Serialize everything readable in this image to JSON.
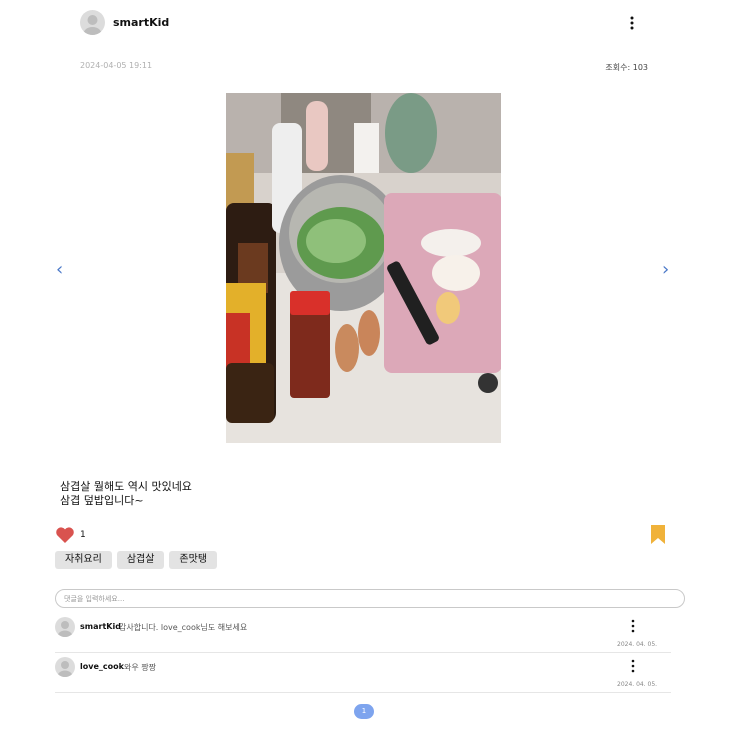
{
  "post": {
    "author": "smartKid",
    "date": "2024-04-05 19:11",
    "views": "조회수: 103",
    "text_line1": "삼겹살 뭘해도 역시 맛있네요",
    "text_line2": "삼겹 덮밥입니다~",
    "like_count": "1",
    "liked": true,
    "bookmarked": true
  },
  "carousel": {
    "prev": "‹",
    "next": "›"
  },
  "tags": [
    "자취요리",
    "삼겹살",
    "존맛탱"
  ],
  "comment_box": {
    "placeholder": "댓글을 입력하세요..."
  },
  "comments": [
    {
      "author": "smartKid",
      "text": "감사합니다. love_cook님도 해보세요",
      "date": "2024. 04. 05."
    },
    {
      "author": "love_cook",
      "text": "와우 짱짱",
      "date": "2024. 04. 05."
    }
  ],
  "pagination": {
    "current": "1"
  },
  "colors": {
    "like": "#d9534f",
    "bookmark": "#f0b23a",
    "page_active": "#7ea4ee",
    "nav_arrow": "#4a78c8"
  }
}
